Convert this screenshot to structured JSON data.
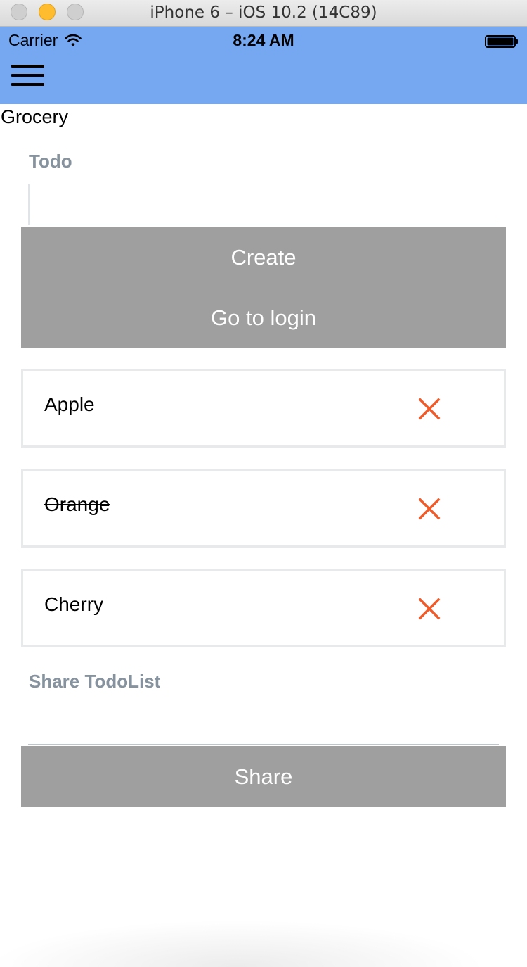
{
  "window": {
    "title": "iPhone 6 – iOS 10.2 (14C89)"
  },
  "status_bar": {
    "carrier": "Carrier",
    "time": "8:24 AM",
    "wifi_icon": "wifi-icon",
    "battery_icon": "battery-icon"
  },
  "header": {
    "menu_icon": "hamburger-menu-icon",
    "background_color": "#76a8f2"
  },
  "page": {
    "title": "Grocery"
  },
  "todo_form": {
    "label": "Todo",
    "input_value": "",
    "create_label": "Create",
    "login_label": "Go to login",
    "button_color": "#9f9f9f"
  },
  "todos": [
    {
      "text": "Apple",
      "completed": false
    },
    {
      "text": "Orange",
      "completed": true
    },
    {
      "text": "Cherry",
      "completed": false
    }
  ],
  "delete_icon": {
    "name": "close-x-icon",
    "color": "#f05a28"
  },
  "share_form": {
    "label": "Share TodoList",
    "input_value": "",
    "share_label": "Share"
  }
}
